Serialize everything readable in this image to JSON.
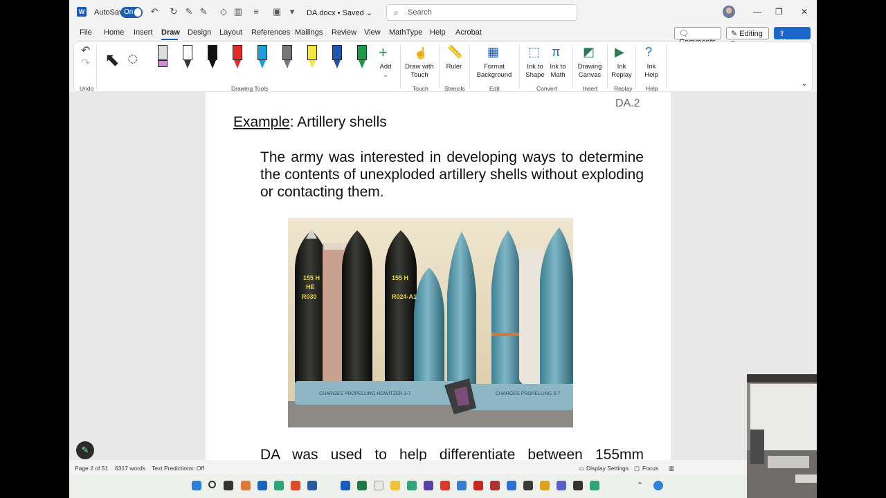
{
  "titlebar": {
    "app_logo": "W",
    "autosave_label": "AutoSave",
    "autosave_state": "On",
    "document_name": "DA.docx • Saved ⌄",
    "search_placeholder": "Search"
  },
  "tabs": [
    "File",
    "Home",
    "Insert",
    "Draw",
    "Design",
    "Layout",
    "References",
    "Mailings",
    "Review",
    "View",
    "MathType",
    "Help",
    "Acrobat"
  ],
  "active_tab": "Draw",
  "top_right": {
    "comments": "Comments",
    "editing": "Editing",
    "share": "Share"
  },
  "ribbon": {
    "undo_group": "Undo",
    "drawing_tools_group": "Drawing Tools",
    "add_label": "Add",
    "draw_with_touch": "Draw with Touch",
    "touch_group": "Touch",
    "ruler": "Ruler",
    "stencils_group": "Stencils",
    "format_background": "Format Background",
    "edit_group": "Edit",
    "ink_to_shape": "Ink to Shape",
    "ink_to_math": "Ink to Math",
    "convert_group": "Convert",
    "drawing_canvas": "Drawing Canvas",
    "insert_group": "Insert",
    "ink_replay": "Ink Replay",
    "replay_group": "Replay",
    "ink_help": "Ink Help",
    "help_group": "Help",
    "pen_colors": [
      "#111111",
      "#e52a2a",
      "#1b9fd8",
      "#777777",
      "#f5e63a",
      "#1e56b0",
      "#1c9a4a"
    ]
  },
  "document": {
    "page_label": "DA.2",
    "heading_prefix": "Example",
    "heading_rest": ": Artillery shells",
    "paragraph1": "The army was interested in developing ways to determine the contents of unexploded artillery shells without exploding or contacting them.",
    "paragraph2": "DA was used to help differentiate between 155mm"
  },
  "status": {
    "page": "Page 2 of 51",
    "words": "6317 words",
    "text_predictions": "Text Predictions: Off",
    "display_settings": "Display Settings",
    "focus": "Focus"
  }
}
